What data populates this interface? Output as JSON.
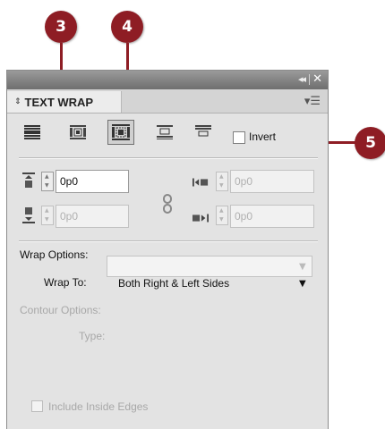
{
  "callouts": {
    "c3": "3",
    "c4": "4",
    "c5": "5"
  },
  "panel": {
    "tab_label": "TEXT WRAP",
    "wrap_buttons": [
      {
        "name": "no-text-wrap",
        "selected": false
      },
      {
        "name": "wrap-around-bounding-box",
        "selected": false
      },
      {
        "name": "wrap-around-object-shape",
        "selected": true
      },
      {
        "name": "jump-object",
        "selected": false
      },
      {
        "name": "jump-to-next-column",
        "selected": false
      }
    ],
    "invert_label": "Invert",
    "offsets": {
      "top": "0p0",
      "bottom": "0p0",
      "left": "0p0",
      "right": "0p0"
    },
    "wrap_options_label": "Wrap Options:",
    "wrap_to_label": "Wrap To:",
    "wrap_to_value": "Both Right & Left Sides",
    "contour_options_label": "Contour Options:",
    "type_label": "Type:",
    "include_inside_edges_label": "Include Inside Edges"
  },
  "colors": {
    "callout": "#8e1d24",
    "panel_bg": "#e3e3e3",
    "titlebar": "#7a7a7a"
  }
}
